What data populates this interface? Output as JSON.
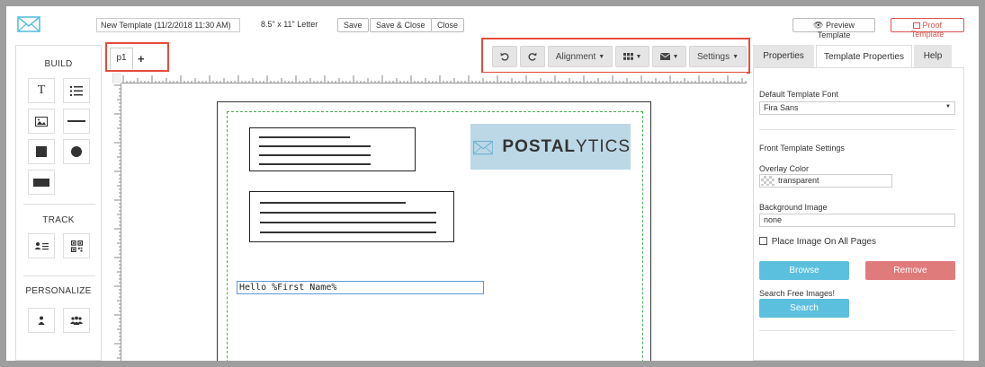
{
  "header": {
    "template_name": "New Template (11/2/2018 11:30 AM)",
    "page_size": "8.5\" x 11\" Letter",
    "save_label": "Save",
    "save_close_label": "Save & Close",
    "close_label": "Close",
    "preview_label": "Preview Template",
    "proof_label": "Proof Template"
  },
  "sidebar": {
    "build_title": "BUILD",
    "track_title": "TRACK",
    "personalize_title": "PERSONALIZE",
    "text_tool_glyph": "T"
  },
  "pages": {
    "tabs": [
      "p1"
    ],
    "add_label": "+"
  },
  "toolbar": {
    "undo_icon": "undo-icon",
    "redo_icon": "redo-icon",
    "alignment_label": "Alignment",
    "grid_icon": "grid-icon",
    "mail_icon": "envelope-icon",
    "settings_label": "Settings"
  },
  "canvas": {
    "logo_text_bold": "POSTAL",
    "logo_text_light": "YTICS",
    "hello_text": "Hello  %First Name%"
  },
  "right_panel": {
    "tabs": [
      "Properties",
      "Template Properties",
      "Help"
    ],
    "active_tab": "Template Properties",
    "font_label": "Default Template Font",
    "font_value": "Fira Sans",
    "front_settings_label": "Front Template Settings",
    "overlay_label": "Overlay Color",
    "overlay_value": "transparent",
    "bg_image_label": "Background Image",
    "bg_image_value": "none",
    "place_image_label": "Place Image On All Pages",
    "browse_label": "Browse",
    "remove_label": "Remove",
    "search_free_label": "Search Free Images!",
    "search_label": "Search"
  },
  "colors": {
    "accent_blue": "#5bc0de",
    "danger_red": "#e07b7b",
    "highlight_red": "#e74c3c",
    "logo_bg": "#bcd8e6"
  }
}
